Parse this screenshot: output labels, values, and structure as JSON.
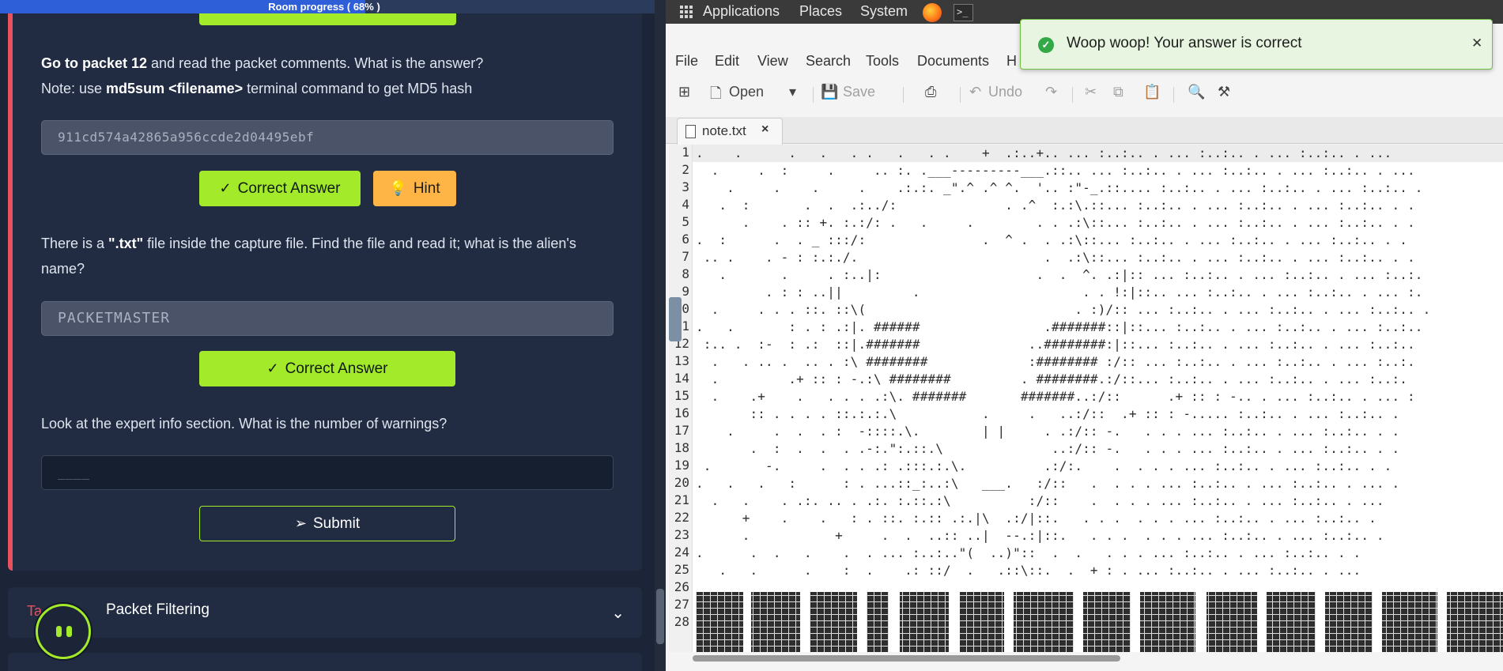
{
  "progress": {
    "label": "Room progress ( 68% )",
    "value": 0.68
  },
  "questions": [
    {
      "prefix_bold": "Go to packet 12",
      "text": " and read the packet comments. What is the answer?",
      "note_prefix": "Note: use ",
      "note_bold": "md5sum <filename>",
      "note_suffix": " terminal command to get MD5 hash",
      "answer": "911cd574a42865a956ccde2d04495ebf",
      "button": "Correct Answer",
      "hint": "Hint"
    },
    {
      "text_a": "There is a ",
      "text_bold": "\".txt\"",
      "text_b": " file inside the capture file. Find the file and read it; what is the alien's",
      "text_c": "name?",
      "answer": "PACKETMASTER",
      "button": "Correct Answer"
    },
    {
      "text": "Look at the expert info section. What is the number of warnings?",
      "placeholder": "____",
      "button": "Submit"
    }
  ],
  "next_task": {
    "prefix": "Ta",
    "title": "Packet Filtering"
  },
  "desktop": {
    "menu": [
      "Applications",
      "Places",
      "System"
    ]
  },
  "editor": {
    "menu": [
      "File",
      "Edit",
      "View",
      "Search",
      "Tools",
      "Documents",
      "H"
    ],
    "toolbar": {
      "open": "Open",
      "save": "Save",
      "undo": "Undo"
    },
    "tab": "note.txt",
    "line_numbers": [
      "1",
      "2",
      "3",
      "4",
      "5",
      "6",
      "7",
      "8",
      "9",
      "0",
      "1",
      "12",
      "13",
      "14",
      "15",
      "16",
      "17",
      "18",
      "19",
      "20",
      "21",
      "22",
      "23",
      "24",
      "25",
      "26",
      "27",
      "28"
    ],
    "lines": [
      ".    .      .   .   . .   .   . .    +  .:..+.. ... :..:.. . ... :..:.. . ... :..:.. . ...",
      "  .     .  :     .     .. :. .___---------___.::.. ... :..:.. . ... :..:.. . ... :..:.. . ...",
      "    .     .    .     .    .:.:. _\".^ .^ ^.  '.. :\"-_.::.... :..:.. . ... :..:.. . ... :..:.. .",
      "   .  :       .  .  .:../:              . .^  :.:\\.::... :..:.. . ... :..:.. . ... :..:.. . .",
      "      .    . :: +. :.:/: .   .     .        . . .:\\::... :..:.. . ... :..:.. . ... :..:.. . .",
      ".  :      .  . _ :::/:               .  ^ .  . .:\\::... :..:.. . ... :..:.. . ... :..:.. . .",
      " .. .    . - : :.:./.                        .  .:\\::... :..:.. . ... :..:.. . ... :..:.. . .",
      "   .       .     . :..|:                    .  .  ^. .:|:: ... :..:.. . ... :..:.. . ... :..:.",
      "         . : : ..||         .                     . . !:|::.. ... :..:.. . ... :..:.. . ... :.",
      "  .     . . . ::. ::\\(                           . :)/:: ... :..:.. . ... :..:.. . ... :..:.. .",
      ".   .       : . : .:|. ######                .#######::|::... :..:.. . ... :..:.. . ... :..:..",
      " :.. .  :-  : .:  ::|.#######              ..########:|::... :..:.. . ... :..:.. . ... :..:..",
      "  .   . .. .  .. . :\\ ########             :######## :/:: ... :..:.. . ... :..:.. . ... :..:.",
      "  .         .+ :: : -.:\\ ########         . ########.:/::... :..:.. . ... :..:.. . ... :..:.",
      "  .    .+    .   . . . .:\\. #######       #######..:/::      .+ :: : -.. . ... :..:.. . ... :",
      "       :: . . . . ::.:.:.\\           .     .   ..:/::  .+ :: : -..... :..:.. . ... :..:.. .",
      "    .     .  .  . :  -::::.\\.        | |     . .:/:: -.   . . . ... :..:.. . ... :..:.. . .",
      "       .  :  .  .  . .-:.\":.::.\\              ..:/:: -.   . . . ... :..:.. . ... :..:.. . .",
      " .       -.     .  . . .: .:::.:.\\.          .:/:.    .  . . . ... :..:.. . ... :..:.. . .",
      ".   .   .   :      : . ...::_:..:\\   ___.   :/::   .  . . . ... :..:.. . ... :..:.. . ... .",
      "  .   .    . .:. .. . .:. :.::.:\\          :/::    .  . . . ... :..:.. . ... :..:.. . ...",
      "      +    .    .   : . ::. :.:: .:.|\\  .:/|::.   . . .  . . . ... :..:.. . ... :..:.. .",
      "      .           +     .  .  ..:: ..|  --.:|::.   . . .  . . . ... :..:.. . ... :..:.. .",
      ".      .  .   .    .  . ... :..:..\"(  ..)\"::  .  .   . . . ... :..:.. . ... :..:.. . .",
      "   .   .      .    :  .    .: ::/  .   .::\\::.  .  + : . ... :..:.. . ... :..:.. . ..."
    ]
  },
  "toast": {
    "message": "Woop woop! Your answer is correct"
  }
}
